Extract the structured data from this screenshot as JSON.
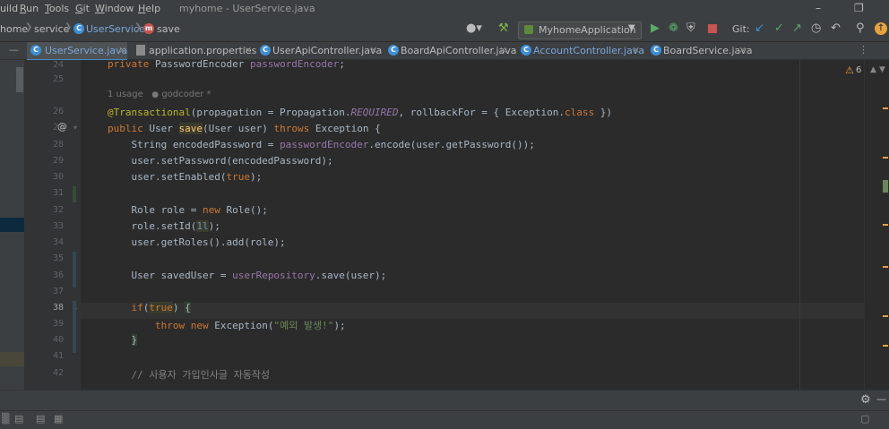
{
  "menu": [
    {
      "label": "uild",
      "mnemonic": ""
    },
    {
      "label": "un",
      "mnemonic": "R"
    },
    {
      "label": "ools",
      "mnemonic": "T"
    },
    {
      "label": "it",
      "mnemonic": "G"
    },
    {
      "label": "indow",
      "mnemonic": "W"
    },
    {
      "label": "elp",
      "mnemonic": "H"
    }
  ],
  "window_title": "myhome - UserService.java",
  "breadcrumbs": {
    "project": "home",
    "package": "service",
    "class": "UserService",
    "method": "save"
  },
  "run_config": "MyhomeApplication",
  "vcs_label": "Git:",
  "tabs": [
    {
      "label": "UserService.java",
      "icon": "C",
      "color": "#3d8fd6"
    },
    {
      "label": "application.properties",
      "icon": "P",
      "color": "#8a8a8a"
    },
    {
      "label": "UserApiController.java",
      "icon": "C",
      "color": "#3d8fd6"
    },
    {
      "label": "BoardApiController.java",
      "icon": "C",
      "color": "#3d8fd6"
    },
    {
      "label": "AccountController.java",
      "icon": "C",
      "color": "#3d8fd6"
    },
    {
      "label": "BoardService.java",
      "icon": "C",
      "color": "#3d8fd6"
    }
  ],
  "line_numbers": [
    "24",
    "25",
    "26",
    "27",
    "28",
    "29",
    "30",
    "31",
    "32",
    "33",
    "34",
    "35",
    "36",
    "37",
    "38",
    "39",
    "40",
    "41",
    "42"
  ],
  "usage_hint": {
    "usages": "1 usage",
    "author": "godcoder *"
  },
  "warnings_count": "6",
  "colors": {
    "accent": "#4a88c7",
    "keyword": "#cc7832",
    "annotation": "#bbb529",
    "field": "#9876aa",
    "string": "#6a8759",
    "comment": "#808080",
    "warning": "#e8a33d"
  }
}
